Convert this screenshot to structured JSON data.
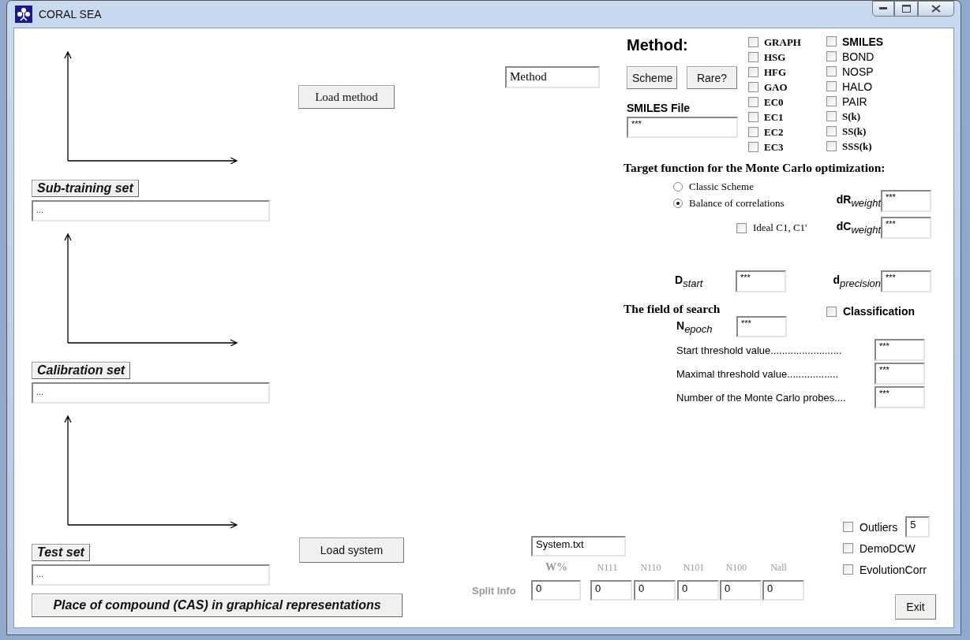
{
  "window": {
    "title": "CORAL SEA"
  },
  "sets": [
    {
      "label": "Sub-training set",
      "value": "..."
    },
    {
      "label": "Calibration set",
      "value": "..."
    },
    {
      "label": "Test set",
      "value": "..."
    }
  ],
  "load_method_button": "Load method",
  "method_field": "Method",
  "load_system_button": "Load system",
  "cas_button": "Place of compound (CAS) in graphical representations",
  "method": {
    "title": "Method:",
    "buttons": [
      "Scheme",
      "Rare?"
    ],
    "smiles_file": {
      "label": "SMILES File",
      "value": "***"
    },
    "columns": [
      [
        {
          "label": "GRAPH",
          "checked": false,
          "kind": "serif"
        },
        {
          "label": "HSG",
          "checked": false,
          "kind": "serif"
        },
        {
          "label": "HFG",
          "checked": false,
          "kind": "serif"
        },
        {
          "label": "GAO",
          "checked": false,
          "kind": "serif"
        },
        {
          "label": "EC0",
          "checked": false,
          "kind": "serif"
        },
        {
          "label": "EC1",
          "checked": false,
          "kind": "serif"
        },
        {
          "label": "EC2",
          "checked": false,
          "kind": "serif"
        },
        {
          "label": "EC3",
          "checked": false,
          "kind": "serif"
        }
      ],
      [
        {
          "label": "SMILES",
          "checked": false,
          "kind": "bold"
        },
        {
          "label": "BOND",
          "checked": false,
          "kind": "sans"
        },
        {
          "label": "NOSP",
          "checked": false,
          "kind": "sans"
        },
        {
          "label": "HALO",
          "checked": false,
          "kind": "sans"
        },
        {
          "label": "PAIR",
          "checked": false,
          "kind": "sans"
        },
        {
          "label": "S(k)",
          "checked": false,
          "kind": "serif"
        },
        {
          "label": "SS(k)",
          "checked": false,
          "kind": "serif"
        },
        {
          "label": "SSS(k)",
          "checked": false,
          "kind": "serif"
        }
      ]
    ]
  },
  "target": {
    "title": "Target function for the Monte Carlo optimization:",
    "radios": [
      {
        "label": "Classic Scheme",
        "selected": false
      },
      {
        "label": "Balance of correlations",
        "selected": true
      }
    ],
    "ideal": {
      "label": "Ideal C1, C1'",
      "checked": false
    },
    "weights": [
      {
        "label": "dR$_{weight}$",
        "value": "***"
      },
      {
        "label": "dC$_{weight}$",
        "value": "***"
      }
    ]
  },
  "d_start": {
    "label": "D$_{start}$",
    "value": "***"
  },
  "d_precision": {
    "label": "d$_{precision}$",
    "value": "***"
  },
  "search": {
    "title": "The field of search",
    "classification": {
      "label": "Classification",
      "checked": false
    },
    "n_epoch": {
      "label": "N$_{epoch}$",
      "value": "***"
    },
    "thresholds": [
      {
        "label": "Start threshold value.........................",
        "value": "***"
      },
      {
        "label": "Maximal threshold value..................",
        "value": "***"
      },
      {
        "label": "Number of the Monte Carlo probes....",
        "value": "***"
      }
    ]
  },
  "system_field": "System.txt",
  "split": {
    "label": "Split Info",
    "headers": [
      "W%",
      "N111",
      "N110",
      "N101",
      "N100",
      "Nall"
    ],
    "values": [
      "0",
      "0",
      "0",
      "0",
      "0",
      "0"
    ]
  },
  "options": [
    {
      "label": "Outliers",
      "checked": false,
      "value": "5"
    },
    {
      "label": "DemoDCW",
      "checked": false
    },
    {
      "label": "EvolutionCorr",
      "checked": false
    }
  ],
  "exit_button": "Exit"
}
